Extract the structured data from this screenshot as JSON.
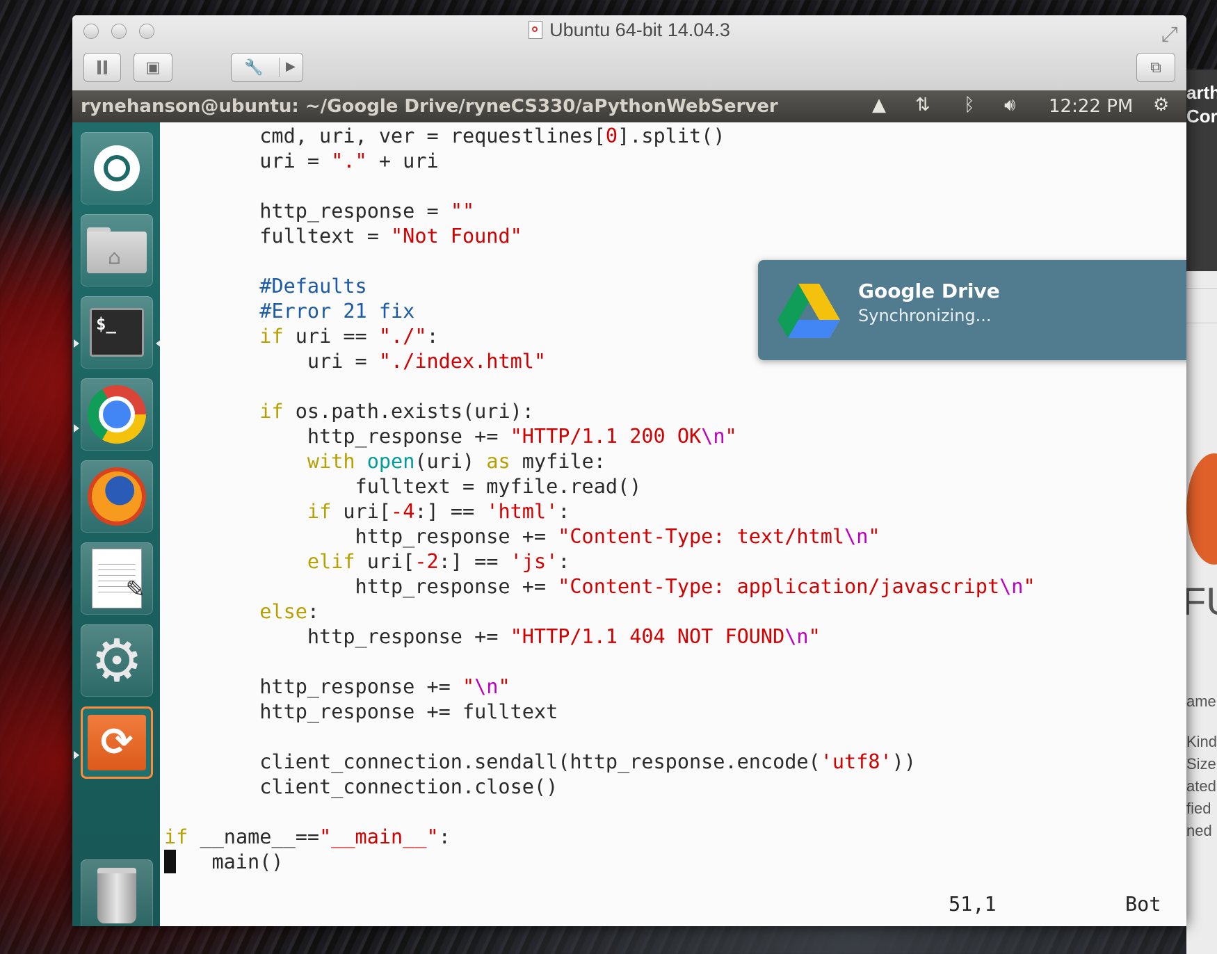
{
  "vm_window": {
    "title": "Ubuntu 64-bit 14.04.3"
  },
  "ubuntu_panel": {
    "window_title": "rynehanson@ubuntu: ~/Google Drive/ryneCS330/aPythonWebServer",
    "clock": "12:22 PM",
    "indicators": [
      "google-drive-icon",
      "network-arrows-icon",
      "bluetooth-icon",
      "volume-icon",
      "power-gear-icon"
    ]
  },
  "launcher": {
    "items": [
      "ubuntu-dash",
      "files-home",
      "terminal",
      "chrome",
      "firefox",
      "text-editor",
      "system-settings",
      "software-updater",
      "trash"
    ],
    "terminal_icon_text": "$_"
  },
  "notification": {
    "title": "Google Drive",
    "body": "Synchronizing..."
  },
  "editor": {
    "lines": [
      [
        {
          "t": "        cmd, uri, ver = requestlines["
        },
        {
          "t": "0",
          "c": "str"
        },
        {
          "t": "].split()"
        }
      ],
      [
        {
          "t": "        uri = "
        },
        {
          "t": "\".\"",
          "c": "str"
        },
        {
          "t": " + uri"
        }
      ],
      [
        {
          "t": ""
        }
      ],
      [
        {
          "t": "        http_response = "
        },
        {
          "t": "\"\"",
          "c": "str"
        }
      ],
      [
        {
          "t": "        fulltext = "
        },
        {
          "t": "\"Not Found\"",
          "c": "str"
        }
      ],
      [
        {
          "t": ""
        }
      ],
      [
        {
          "t": "        "
        },
        {
          "t": "#Defaults",
          "c": "cmt"
        }
      ],
      [
        {
          "t": "        "
        },
        {
          "t": "#Error 21 fix",
          "c": "cmt"
        }
      ],
      [
        {
          "t": "        "
        },
        {
          "t": "if",
          "c": "kw"
        },
        {
          "t": " uri == "
        },
        {
          "t": "\"./\"",
          "c": "str"
        },
        {
          "t": ":"
        }
      ],
      [
        {
          "t": "            uri = "
        },
        {
          "t": "\"./index.html\"",
          "c": "str"
        }
      ],
      [
        {
          "t": ""
        }
      ],
      [
        {
          "t": "        "
        },
        {
          "t": "if",
          "c": "kw"
        },
        {
          "t": " os.path.exists(uri):"
        }
      ],
      [
        {
          "t": "            http_response += "
        },
        {
          "t": "\"HTTP/1.1 200 OK",
          "c": "str"
        },
        {
          "t": "\\n",
          "c": "esc"
        },
        {
          "t": "\"",
          "c": "str"
        }
      ],
      [
        {
          "t": "            "
        },
        {
          "t": "with",
          "c": "kw"
        },
        {
          "t": " "
        },
        {
          "t": "open",
          "c": "blt"
        },
        {
          "t": "(uri) "
        },
        {
          "t": "as",
          "c": "kw"
        },
        {
          "t": " myfile:"
        }
      ],
      [
        {
          "t": "                fulltext = myfile.read()"
        }
      ],
      [
        {
          "t": "            "
        },
        {
          "t": "if",
          "c": "kw"
        },
        {
          "t": " uri["
        },
        {
          "t": "-4",
          "c": "str"
        },
        {
          "t": ":] == "
        },
        {
          "t": "'html'",
          "c": "str"
        },
        {
          "t": ":"
        }
      ],
      [
        {
          "t": "                http_response += "
        },
        {
          "t": "\"Content-Type: text/html",
          "c": "str"
        },
        {
          "t": "\\n",
          "c": "esc"
        },
        {
          "t": "\"",
          "c": "str"
        }
      ],
      [
        {
          "t": "            "
        },
        {
          "t": "elif",
          "c": "kw"
        },
        {
          "t": " uri["
        },
        {
          "t": "-2",
          "c": "str"
        },
        {
          "t": ":] == "
        },
        {
          "t": "'js'",
          "c": "str"
        },
        {
          "t": ":"
        }
      ],
      [
        {
          "t": "                http_response += "
        },
        {
          "t": "\"Content-Type: application/javascript",
          "c": "str"
        },
        {
          "t": "\\n",
          "c": "esc"
        },
        {
          "t": "\"",
          "c": "str"
        }
      ],
      [
        {
          "t": "        "
        },
        {
          "t": "else",
          "c": "kw"
        },
        {
          "t": ":"
        }
      ],
      [
        {
          "t": "            http_response += "
        },
        {
          "t": "\"HTTP/1.1 404 NOT FOUND",
          "c": "str"
        },
        {
          "t": "\\n",
          "c": "esc"
        },
        {
          "t": "\"",
          "c": "str"
        }
      ],
      [
        {
          "t": ""
        }
      ],
      [
        {
          "t": "        http_response += "
        },
        {
          "t": "\"",
          "c": "str"
        },
        {
          "t": "\\n",
          "c": "esc"
        },
        {
          "t": "\"",
          "c": "str"
        }
      ],
      [
        {
          "t": "        http_response += fulltext"
        }
      ],
      [
        {
          "t": ""
        }
      ],
      [
        {
          "t": "        client_connection.sendall(http_response.encode("
        },
        {
          "t": "'utf8'",
          "c": "str"
        },
        {
          "t": "))"
        }
      ],
      [
        {
          "t": "        client_connection.close()"
        }
      ],
      [
        {
          "t": ""
        }
      ],
      [
        {
          "t": "if",
          "c": "kw"
        },
        {
          "t": " __name__=="
        },
        {
          "t": "\"__main__\"",
          "c": "str"
        },
        {
          "t": ":"
        }
      ],
      [
        {
          "cursor": true
        },
        {
          "t": "   main()"
        }
      ]
    ],
    "status_position": "51,1",
    "status_scroll": "Bot"
  },
  "background_window": {
    "title_fragment_1": "arth",
    "title_fragment_2": "Cor",
    "big_text": "FU",
    "labels": [
      "ame",
      "Kind",
      "Size",
      "ated",
      "fied",
      "ned"
    ]
  },
  "colors": {
    "keyword": "#b8a000",
    "string": "#d40000",
    "comment": "#1a5aa6",
    "builtin": "#009c9c",
    "escape": "#c000c0",
    "notification_bg": "#4a768a",
    "launcher_bg": "#1f6c6a",
    "panel_bg": "#4a4945"
  }
}
